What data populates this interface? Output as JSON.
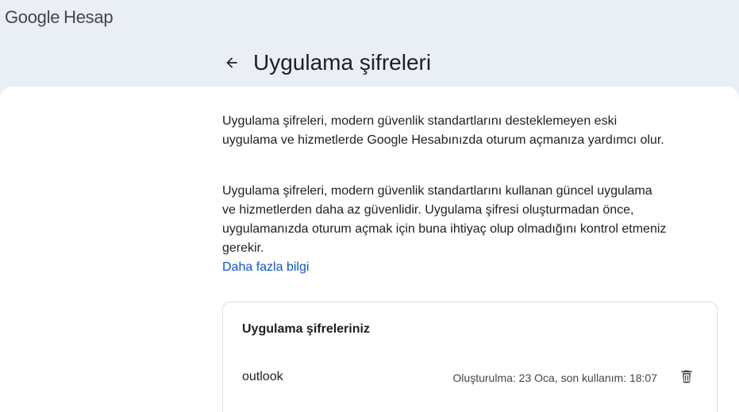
{
  "header": {
    "logo_brand": "Google",
    "logo_product": "Hesap",
    "back_icon": "arrow-back-icon",
    "title": "Uygulama şifreleri"
  },
  "main": {
    "paragraph1": "Uygulama şifreleri, modern güvenlik standartlarını desteklemeyen eski uygulama ve hizmetlerde Google Hesabınızda oturum açmanıza yardımcı olur.",
    "paragraph2": "Uygulama şifreleri, modern güvenlik standartlarını kullanan güncel uygulama ve hizmetlerden daha az güvenlidir. Uygulama şifresi oluşturmadan önce, uygulamanızda oturum açmak için buna ihtiyaç olup olmadığını kontrol etmeniz gerekir.",
    "learn_more": "Daha fazla bilgi"
  },
  "passwords_card": {
    "title": "Uygulama şifreleriniz",
    "items": [
      {
        "name": "outlook",
        "meta": "Oluşturulma: 23 Oca, son kullanım: 18:07",
        "delete_icon": "trash-icon"
      }
    ]
  },
  "colors": {
    "page_background": "#eaeef5",
    "surface": "#ffffff",
    "link": "#0b57d0",
    "text": "#1f1f1f"
  }
}
